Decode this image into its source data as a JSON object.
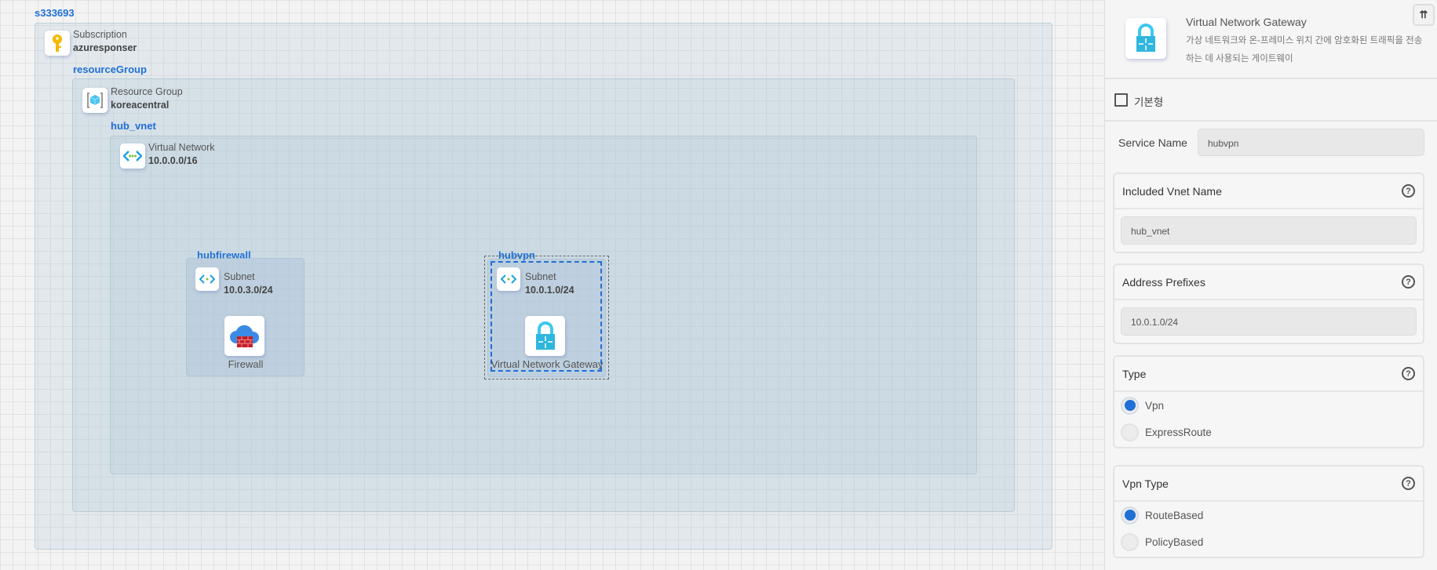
{
  "canvas": {
    "subscription_group_label": "s333693",
    "subscription": {
      "type": "Subscription",
      "name": "azuresponser"
    },
    "resource_group_label": "resourceGroup",
    "resource_group": {
      "type": "Resource Group",
      "name": "koreacentral"
    },
    "vnet_label": "hub_vnet",
    "vnet": {
      "type": "Virtual Network",
      "cidr": "10.0.0.0/16"
    },
    "subnets": [
      {
        "label": "hubfirewall",
        "type": "Subnet",
        "cidr": "10.0.3.0/24",
        "resource": "Firewall"
      },
      {
        "label": "hubvpn",
        "type": "Subnet",
        "cidr": "10.0.1.0/24",
        "resource": "Virtual Network Gateway"
      }
    ]
  },
  "panel": {
    "title": "Virtual Network Gateway",
    "description": "가상 네트워크와 온-프레미스 위치 간에 암호화된 트래픽을 전송하는 데 사용되는 게이트웨이",
    "basic_checkbox": "기본형",
    "service_name_label": "Service Name",
    "service_name_value": "hubvpn",
    "vnet_name_label": "Included Vnet Name",
    "vnet_name_value": "hub_vnet",
    "address_label": "Address Prefixes",
    "address_value": "10.0.1.0/24",
    "type_label": "Type",
    "type_options": [
      "Vpn",
      "ExpressRoute"
    ],
    "vpn_type_label": "Vpn Type",
    "vpn_type_options": [
      "RouteBased",
      "PolicyBased"
    ],
    "help": "?"
  }
}
